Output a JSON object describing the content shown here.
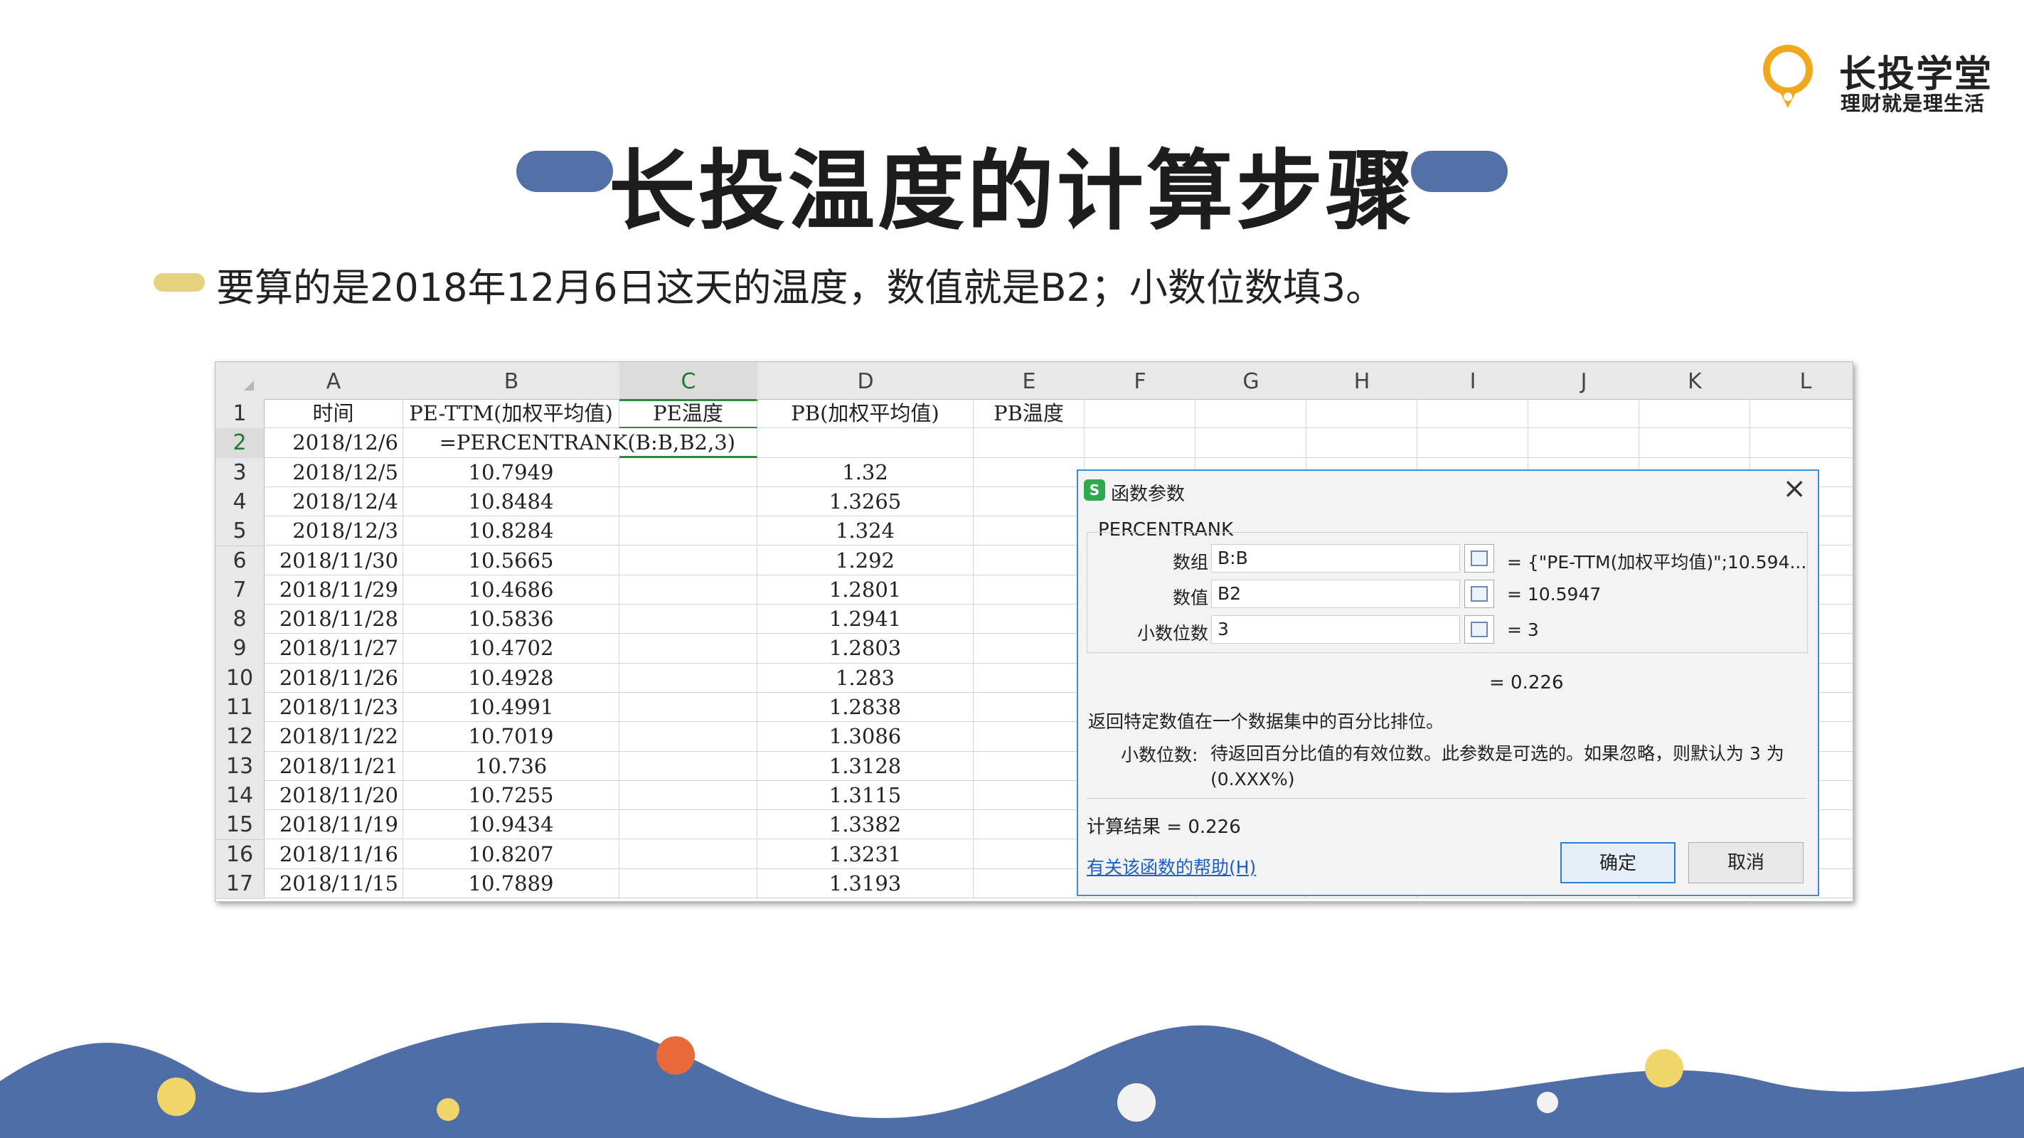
{
  "logo": {
    "brand": "长投学堂",
    "slogan": "理财就是理生活",
    "color": "#f2a81d"
  },
  "title": "长投温度的计算步骤",
  "bullet": "要算的是2018年12月6日这天的温度，数值就是B2；小数位数填3。",
  "sheet": {
    "columns": [
      "A",
      "B",
      "C",
      "D",
      "E",
      "F",
      "G",
      "H",
      "I",
      "J",
      "K",
      "L"
    ],
    "selected_column": "C",
    "row_numbers": [
      "1",
      "2",
      "3",
      "4",
      "5",
      "6",
      "7",
      "8",
      "9",
      "10",
      "11",
      "12",
      "13",
      "14",
      "15",
      "16",
      "17"
    ],
    "selected_row": "2",
    "header_row": [
      "时间",
      "PE-TTM(加权平均值)",
      "PE温度",
      "PB(加权平均值)",
      "PB温度"
    ],
    "formula": "=PERCENTRANK(B:B,B2,3)",
    "dates": [
      "2018/12/6",
      "2018/12/5",
      "2018/12/4",
      "2018/12/3",
      "2018/11/30",
      "2018/11/29",
      "2018/11/28",
      "2018/11/27",
      "2018/11/26",
      "2018/11/23",
      "2018/11/22",
      "2018/11/21",
      "2018/11/20",
      "2018/11/19",
      "2018/11/16",
      "2018/11/15"
    ],
    "pe": [
      "",
      "10.7949",
      "10.8484",
      "10.8284",
      "10.5665",
      "10.4686",
      "10.5836",
      "10.4702",
      "10.4928",
      "10.4991",
      "10.7019",
      "10.736",
      "10.7255",
      "10.9434",
      "10.8207",
      "10.7889"
    ],
    "pb": [
      "",
      "1.32",
      "1.3265",
      "1.324",
      "1.292",
      "1.2801",
      "1.2941",
      "1.2803",
      "1.283",
      "1.2838",
      "1.3086",
      "1.3128",
      "1.3115",
      "1.3382",
      "1.3231",
      "1.3193"
    ]
  },
  "dialog": {
    "title": "函数参数",
    "icon_letter": "S",
    "function_name": "PERCENTRANK",
    "args": [
      {
        "label": "数组",
        "value": "B:B",
        "result": "= {\"PE-TTM(加权平均值)\";10.594..."
      },
      {
        "label": "数值",
        "value": "B2",
        "result": "= 10.5947"
      },
      {
        "label": "小数位数",
        "value": "3",
        "result": "= 3"
      }
    ],
    "result": "= 0.226",
    "description": "返回特定数值在一个数据集中的百分比排位。",
    "param_name": "小数位数:",
    "param_desc": "待返回百分比值的有效位数。此参数是可选的。如果忽略，则默认为 3 为 (0.XXX%)",
    "calc_result": "计算结果 = 0.226",
    "help_link": "有关该函数的帮助(H)",
    "ok": "确定",
    "cancel": "取消"
  },
  "colors": {
    "wave": "#4f6ea8",
    "pill": "#5470a8",
    "bullet_bar": "#e6d27e",
    "dot_orange": "#e8693a",
    "dot_yellow": "#efd56a"
  }
}
